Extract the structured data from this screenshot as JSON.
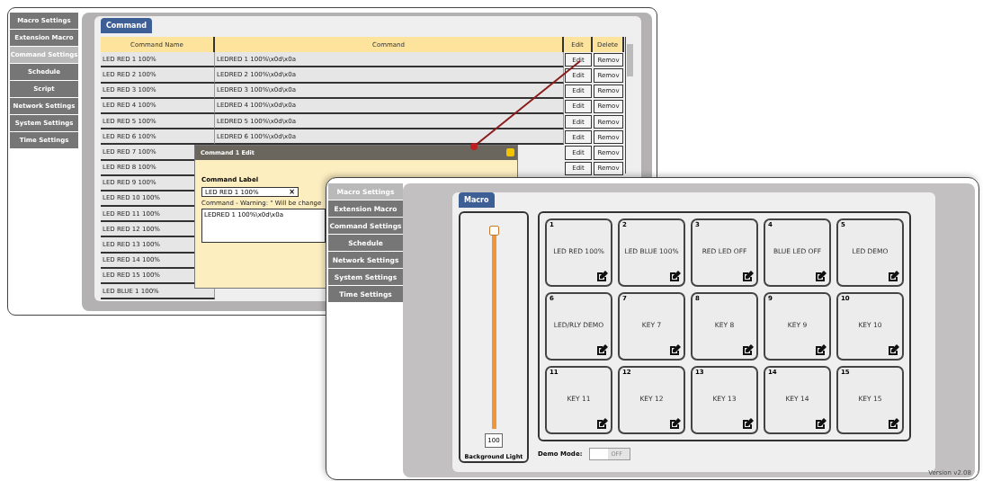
{
  "back_window": {
    "sidebar": [
      {
        "label": "Macro Settings",
        "selected": false
      },
      {
        "label": "Extension Macro",
        "selected": false
      },
      {
        "label": "Command Settings",
        "selected": true
      },
      {
        "label": "Schedule",
        "selected": false
      },
      {
        "label": "Script",
        "selected": false
      },
      {
        "label": "Network Settings",
        "selected": false
      },
      {
        "label": "System Settings",
        "selected": false
      },
      {
        "label": "Time Settings",
        "selected": false
      }
    ],
    "tab": "Command",
    "table": {
      "columns": [
        "Command Name",
        "Command",
        "Edit",
        "Delete"
      ],
      "rows": [
        {
          "name": "LED RED 1 100%",
          "command": "LEDRED 1 100%\\x0d\\x0a",
          "edit": "Edit",
          "delete": "Remov"
        },
        {
          "name": "LED RED 2 100%",
          "command": "LEDRED 2 100%\\x0d\\x0a",
          "edit": "Edit",
          "delete": "Remov"
        },
        {
          "name": "LED RED 3 100%",
          "command": "LEDRED 3 100%\\x0d\\x0a",
          "edit": "Edit",
          "delete": "Remov"
        },
        {
          "name": "LED RED 4 100%",
          "command": "LEDRED 4 100%\\x0d\\x0a",
          "edit": "Edit",
          "delete": "Remov"
        },
        {
          "name": "LED RED 5 100%",
          "command": "LEDRED 5 100%\\x0d\\x0a",
          "edit": "Edit",
          "delete": "Remov"
        },
        {
          "name": "LED RED 6 100%",
          "command": "LEDRED 6 100%\\x0d\\x0a",
          "edit": "Edit",
          "delete": "Remov"
        },
        {
          "name": "LED RED 7 100%",
          "edit": "Edit",
          "delete": "Remov"
        },
        {
          "name": "LED RED 8 100%",
          "edit": "Edit",
          "delete": "Remov"
        },
        {
          "name": "LED RED 9 100%"
        },
        {
          "name": "LED RED 10 100%"
        },
        {
          "name": "LED RED 11 100%"
        },
        {
          "name": "LED RED 12 100%"
        },
        {
          "name": "LED RED 13 100%"
        },
        {
          "name": "LED RED 14 100%"
        },
        {
          "name": "LED RED 15 100%"
        },
        {
          "name": "LED BLUE 1 100%"
        }
      ]
    },
    "dialog": {
      "title": "Command 1 Edit",
      "label_caption": "Command Label",
      "label_value": "LED RED 1 100%",
      "clear": "×",
      "warning": "Command - Warning: \" Will be change",
      "command_value": "LEDRED 1 100%\\x0d\\x0a"
    }
  },
  "front_window": {
    "sidebar": [
      {
        "label": "Macro Settings",
        "selected": true
      },
      {
        "label": "Extension Macro",
        "selected": false
      },
      {
        "label": "Command Settings",
        "selected": false
      },
      {
        "label": "Schedule",
        "selected": false
      },
      {
        "label": "Network Settings",
        "selected": false
      },
      {
        "label": "System Settings",
        "selected": false
      },
      {
        "label": "Time Settings",
        "selected": false
      }
    ],
    "tab": "Macro",
    "slider": {
      "level": 1,
      "value": "100",
      "label": "Background Light"
    },
    "keys": [
      {
        "number": "1",
        "label": "LED RED 100%"
      },
      {
        "number": "2",
        "label": "LED BLUE 100%"
      },
      {
        "number": "3",
        "label": "RED LED OFF"
      },
      {
        "number": "4",
        "label": "BLUE LED OFF"
      },
      {
        "number": "5",
        "label": "LED DEMO"
      },
      {
        "number": "6",
        "label": "LED/RLY DEMO"
      },
      {
        "number": "7",
        "label": "KEY 7"
      },
      {
        "number": "8",
        "label": "KEY 8"
      },
      {
        "number": "9",
        "label": "KEY 9"
      },
      {
        "number": "10",
        "label": "KEY 10"
      },
      {
        "number": "11",
        "label": "KEY 11"
      },
      {
        "number": "12",
        "label": "KEY 12"
      },
      {
        "number": "13",
        "label": "KEY 13"
      },
      {
        "number": "14",
        "label": "KEY 14"
      },
      {
        "number": "15",
        "label": "KEY 15"
      }
    ],
    "demo_mode": {
      "label": "Demo Mode:",
      "on": false,
      "state_text": "OFF"
    },
    "version": "Version v2.08"
  }
}
